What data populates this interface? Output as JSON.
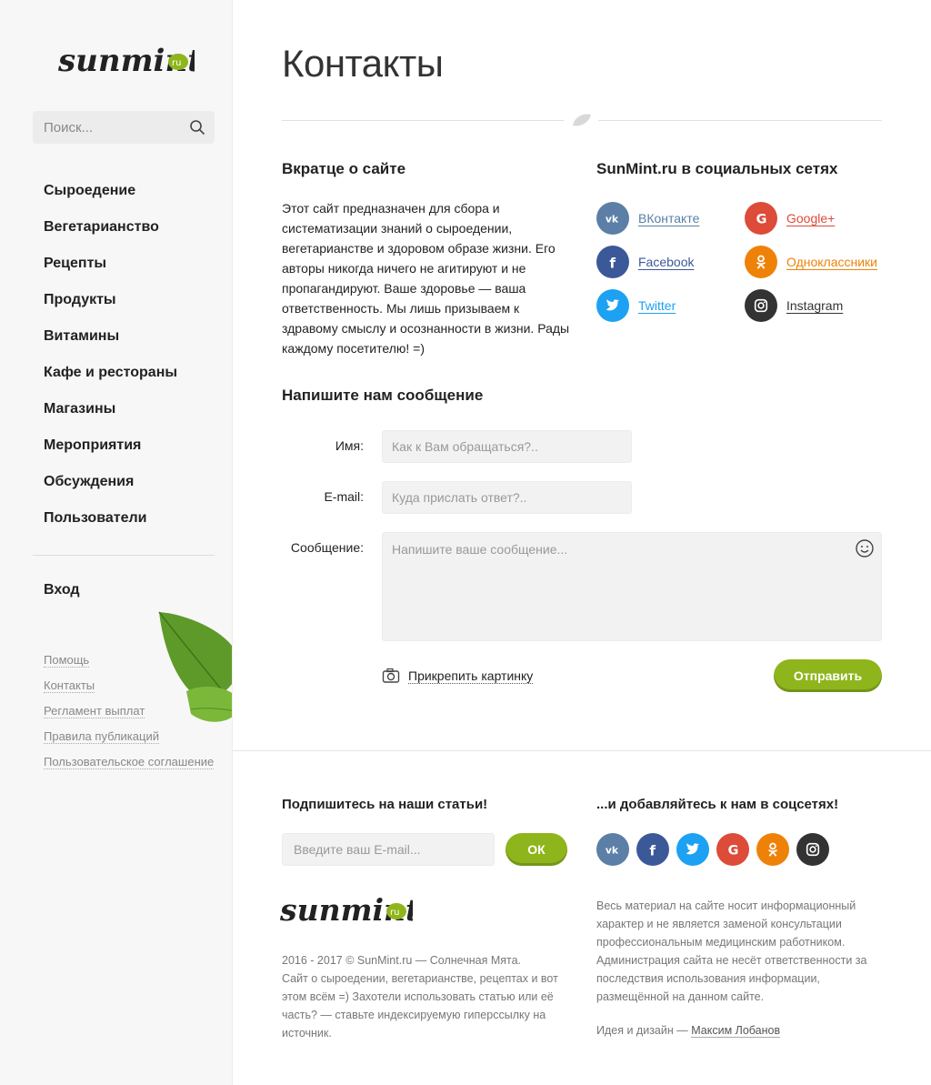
{
  "brand": {
    "logo_text": "sunmint",
    "logo_badge": "ru"
  },
  "search": {
    "placeholder": "Поиск..."
  },
  "nav": {
    "items": [
      "Сыроедение",
      "Вегетарианство",
      "Рецепты",
      "Продукты",
      "Витамины",
      "Кафе и рестораны",
      "Магазины",
      "Мероприятия",
      "Обсуждения",
      "Пользователи"
    ],
    "login": "Вход"
  },
  "sidebar_footer": {
    "links": [
      "Помощь",
      "Контакты",
      "Регламент выплат",
      "Правила публикаций",
      "Пользовательское соглашение"
    ]
  },
  "page": {
    "title": "Контакты"
  },
  "about": {
    "heading": "Вкратце о сайте",
    "text": "Этот сайт предназначен для сбора и систематизации знаний о сыроедении, вегетарианстве и здоровом образе жизни. Его авторы никогда ничего не агитируют и не пропагандируют. Ваше здоровье — ваша ответственность. Мы лишь призываем к здравому смыслу и осознанности в жизни. Рады каждому посетителю! =)"
  },
  "social": {
    "heading": "SunMint.ru в социальных сетях",
    "items": [
      {
        "label": "ВКонтакте",
        "icon": "vk-icon",
        "color": "#5b7fa6"
      },
      {
        "label": "Google+",
        "icon": "google-plus-icon",
        "color": "#dd4b39"
      },
      {
        "label": "Facebook",
        "icon": "facebook-icon",
        "color": "#3b5998"
      },
      {
        "label": "Одноклассники",
        "icon": "odnoklassniki-icon",
        "color": "#ee8208"
      },
      {
        "label": "Twitter",
        "icon": "twitter-icon",
        "color": "#1da1f2"
      },
      {
        "label": "Instagram",
        "icon": "instagram-icon",
        "color": "#333333"
      }
    ]
  },
  "contact_form": {
    "heading": "Напишите нам сообщение",
    "name_label": "Имя:",
    "name_placeholder": "Как к Вам обращаться?..",
    "email_label": "E-mail:",
    "email_placeholder": "Куда прислать ответ?..",
    "message_label": "Сообщение:",
    "message_placeholder": "Напишите ваше сообщение...",
    "attach_label": "Прикрепить картинку",
    "submit_label": "Отправить"
  },
  "footer": {
    "subscribe_heading": "Подпишитесь на наши статьи!",
    "subscribe_placeholder": "Введите ваш E-mail...",
    "ok_label": "ОК",
    "social_heading": "...и добавляйтесь к нам в соцсетях!",
    "about": "2016 - 2017 © SunMint.ru — Солнечная Мята.\nСайт о сыроедении, вегетарианстве, рецептах и вот этом всём =) Захотели использовать статью или её часть? — ставьте индексируемую гиперссылку на источник.",
    "disclaimer": "Весь материал на сайте носит информационный характер и не является заменой консультации профессиональным медицинским работником. Администрация сайта не несёт ответственности за последствия использования информации, размещённой на данном сайте.",
    "credits_prefix": "Идея и дизайн — ",
    "credits_author": "Максим Лобанов"
  },
  "colors": {
    "accent": "#8fb51c",
    "sidebar_bg": "#f7f7f7"
  }
}
